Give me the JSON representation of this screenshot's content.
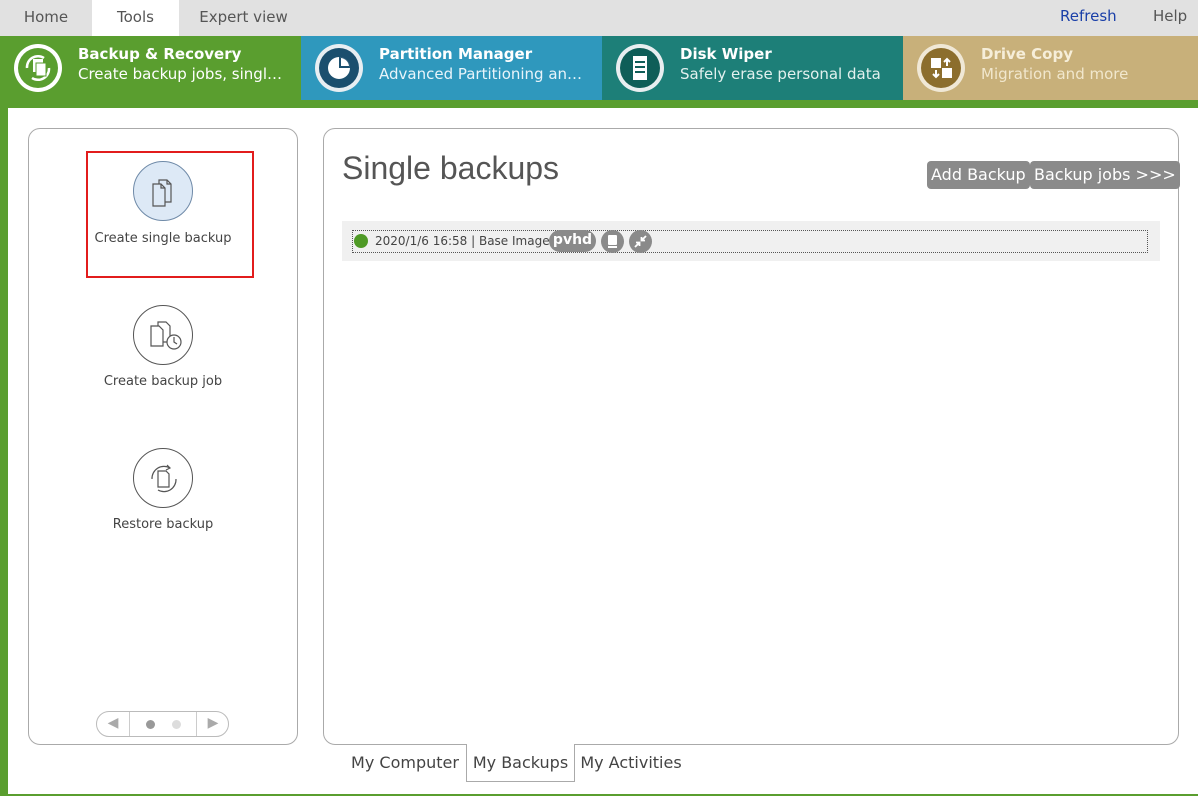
{
  "topnav": {
    "tabs": [
      {
        "label": "Home",
        "active": false
      },
      {
        "label": "Tools",
        "active": true
      },
      {
        "label": "Expert view",
        "active": false
      }
    ],
    "refresh": "Refresh",
    "help": "Help",
    "refresh_color": "#1a3fa8"
  },
  "modules": [
    {
      "title": "Backup & Recovery",
      "subtitle": "Create backup jobs, single b...",
      "icon": "backup-recovery-icon",
      "color": "#5a9e2f",
      "active": true
    },
    {
      "title": "Partition Manager",
      "subtitle": "Advanced Partitioning and s...",
      "icon": "partition-pie-icon",
      "color": "#2f98bd",
      "active": false
    },
    {
      "title": "Disk Wiper",
      "subtitle": "Safely erase personal data",
      "icon": "disk-wiper-icon",
      "color": "#1d7f78",
      "active": false
    },
    {
      "title": "Drive Copy",
      "subtitle": "Migration and more",
      "icon": "drive-copy-icon",
      "color": "#c8b07a",
      "active": false
    }
  ],
  "left_actions": [
    {
      "label": "Create single backup",
      "icon": "single-backup-icon",
      "selected": true
    },
    {
      "label": "Create backup job",
      "icon": "backup-job-icon",
      "selected": false
    },
    {
      "label": "Restore backup",
      "icon": "restore-backup-icon",
      "selected": false
    }
  ],
  "pager": {
    "pages": 2,
    "current": 1
  },
  "main": {
    "title": "Single backups",
    "add_button": "Add Backup",
    "jobs_button": "Backup jobs >>>",
    "backups": [
      {
        "text": "2020/1/6 16:58 | Base Image",
        "badge": "pvhd",
        "status_color": "#4f9a26",
        "icons": [
          "drive-icon",
          "collapse-icon"
        ]
      }
    ]
  },
  "bottom_tabs": [
    {
      "label": "My Computer",
      "active": false
    },
    {
      "label": "My Backups",
      "active": true
    },
    {
      "label": "My Activities",
      "active": false
    }
  ]
}
